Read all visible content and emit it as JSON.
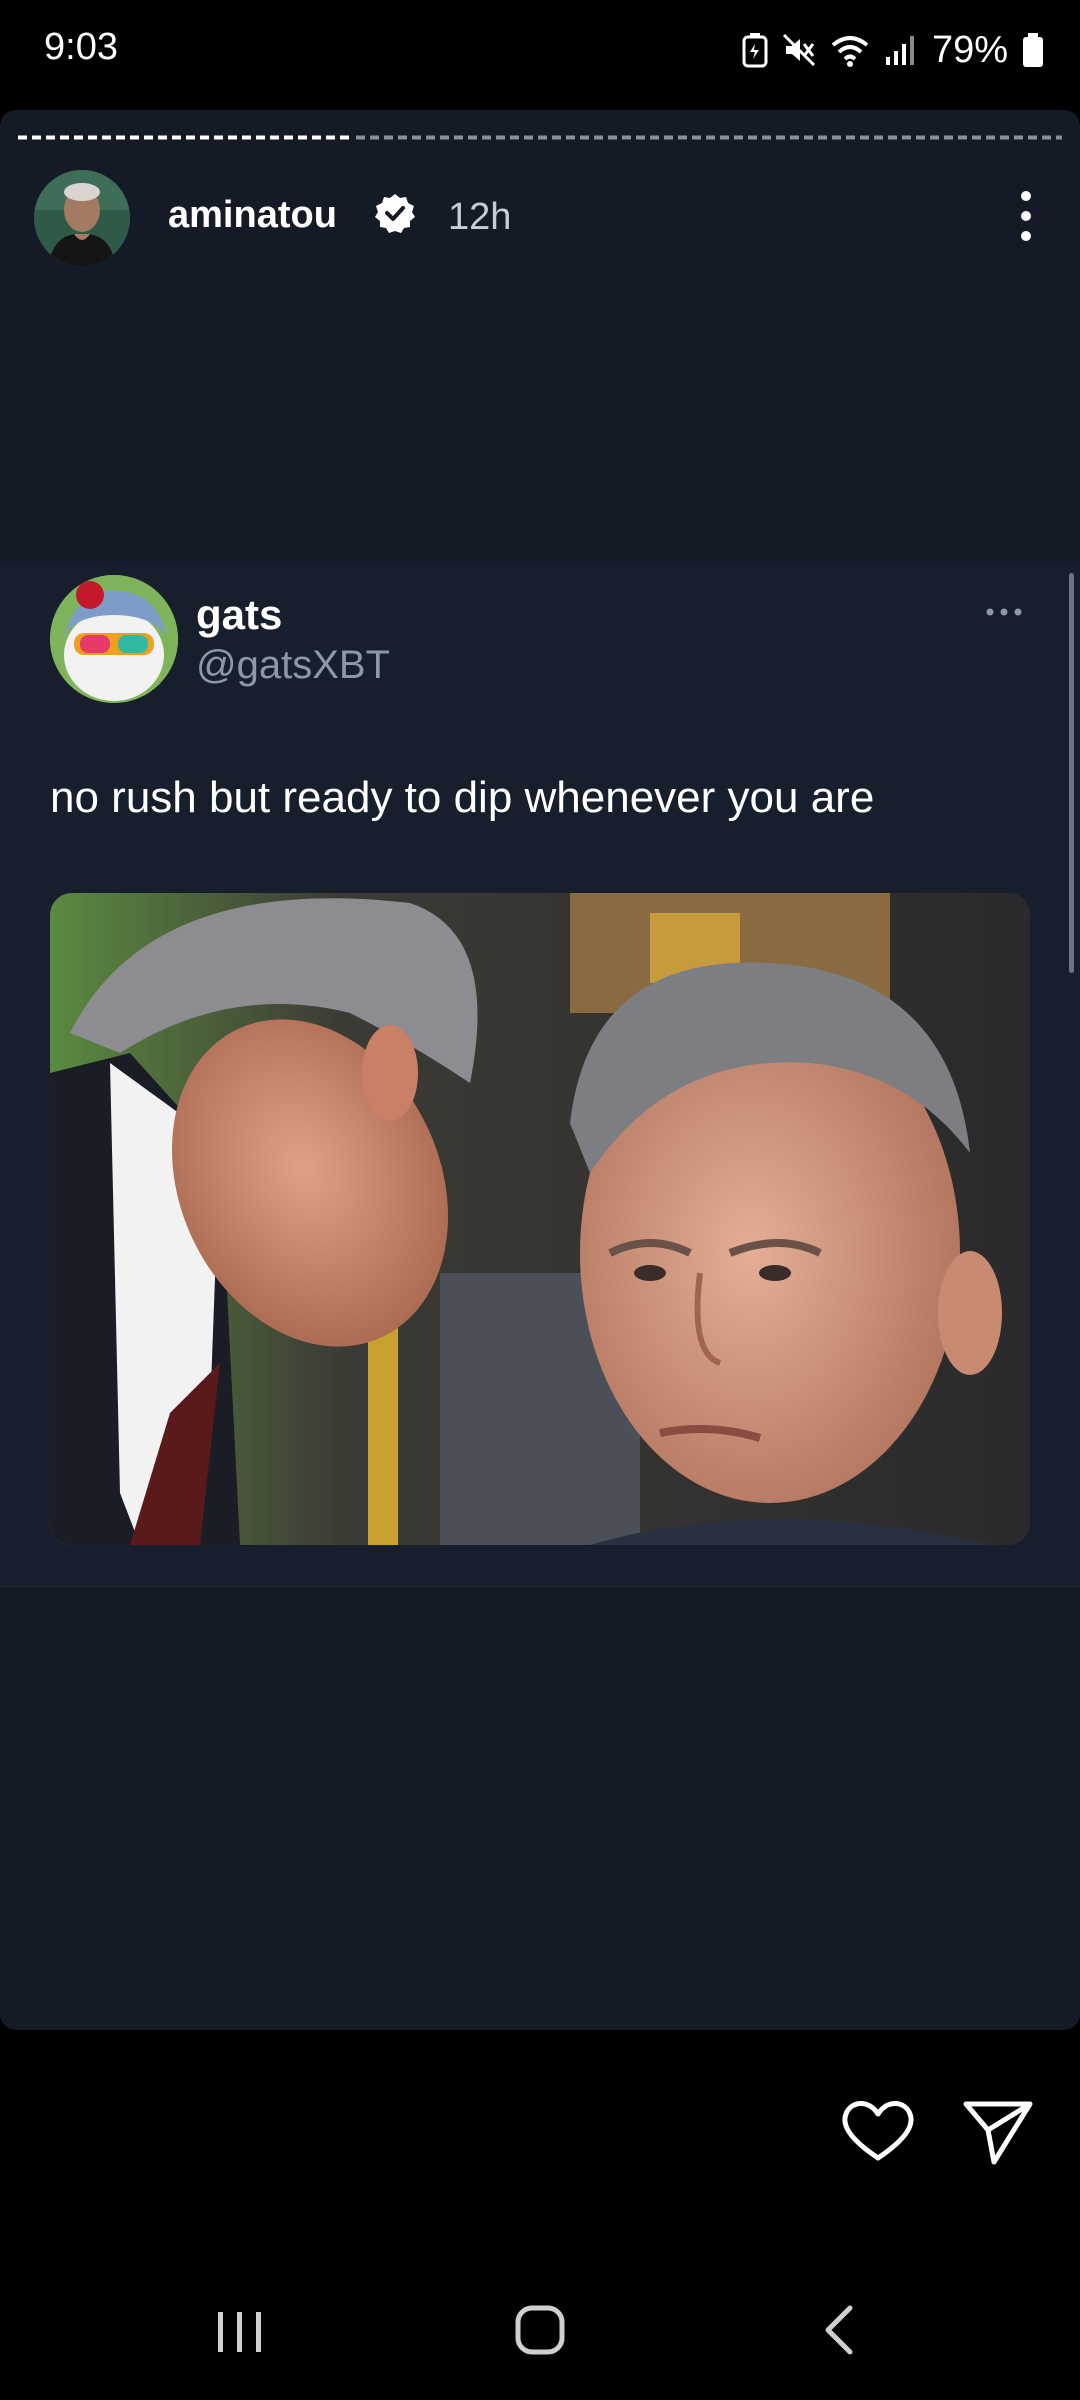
{
  "status_bar": {
    "time": "9:03",
    "battery": "79%"
  },
  "story": {
    "username": "aminatou",
    "time": "12h",
    "progress_fraction": 0.32
  },
  "tweet": {
    "name": "gats",
    "handle": "@gatsXBT",
    "text": "no rush but ready to dip whenever you are"
  },
  "icons": {
    "status": [
      "battery-saver-icon",
      "mute-icon",
      "wifi-icon",
      "signal-icon",
      "battery-icon"
    ],
    "story": [
      "verified-badge-icon",
      "more-vertical-icon"
    ],
    "tweet": [
      "more-horizontal-icon"
    ],
    "actions": [
      "heart-icon",
      "send-icon"
    ],
    "nav": [
      "recent-apps-icon",
      "home-icon",
      "back-icon"
    ]
  },
  "colors": {
    "card_bg": "#151b26",
    "tweet_bg": "#161f2b",
    "handle": "#8b98a5",
    "accent_white": "#ffffff"
  }
}
